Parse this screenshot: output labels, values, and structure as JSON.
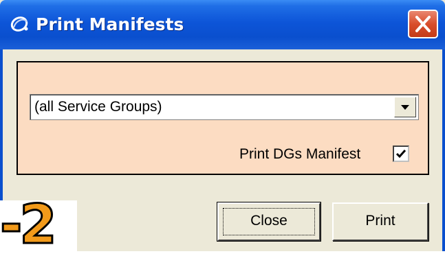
{
  "window": {
    "title": "Print Manifests",
    "close_icon": "close-icon"
  },
  "panel": {
    "service_group_select": {
      "selected": "(all Service Groups)"
    },
    "dgs_checkbox": {
      "label": "Print DGs Manifest",
      "checked": true
    }
  },
  "buttons": {
    "close_label": "Close",
    "print_label": "Print"
  },
  "step_marker": "-2",
  "colors": {
    "titlebar": "#0a4fce",
    "panel_bg": "#fcdcc2",
    "window_bg": "#ece9d8",
    "close_button": "#d94e2c",
    "step_marker": "#f29a1a"
  }
}
